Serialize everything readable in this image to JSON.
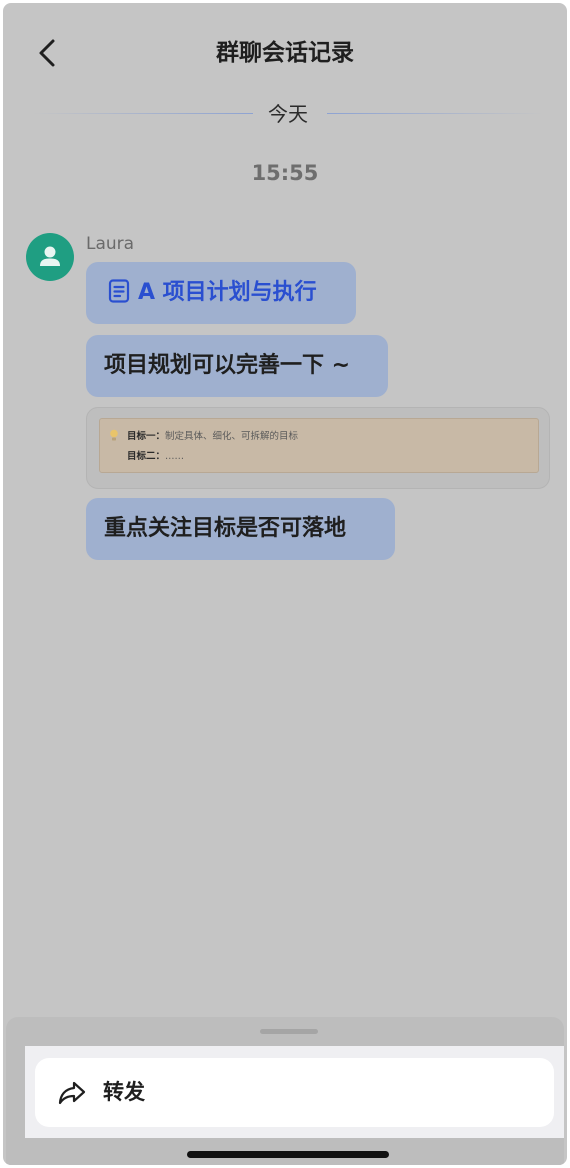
{
  "header": {
    "title": "群聊会话记录",
    "back_icon": "chevron-left-icon"
  },
  "date_divider": {
    "label": "今天"
  },
  "time_label": "15:55",
  "message_group": {
    "sender": "Laura",
    "avatar_icon": "user-icon",
    "avatar_color": "#1f9e82",
    "messages": [
      {
        "type": "doc-link",
        "icon": "document-icon",
        "text": "A 项目计划与执行"
      },
      {
        "type": "text",
        "text": "项目规划可以完善一下 ~"
      },
      {
        "type": "quote-card",
        "icon": "lightbulb-icon",
        "lines": [
          {
            "key": "目标一：",
            "value": "制定具体、细化、可拆解的目标"
          },
          {
            "key": "目标二：",
            "value": "……"
          }
        ]
      },
      {
        "type": "text",
        "text": "重点关注目标是否可落地"
      }
    ]
  },
  "action_sheet": {
    "forward_label": "转发",
    "forward_icon": "share-forward-icon"
  },
  "colors": {
    "bubble": "#9fb0cf",
    "doc_link_text": "#2a4fd0",
    "overlay_background": "#c5c5c5"
  }
}
